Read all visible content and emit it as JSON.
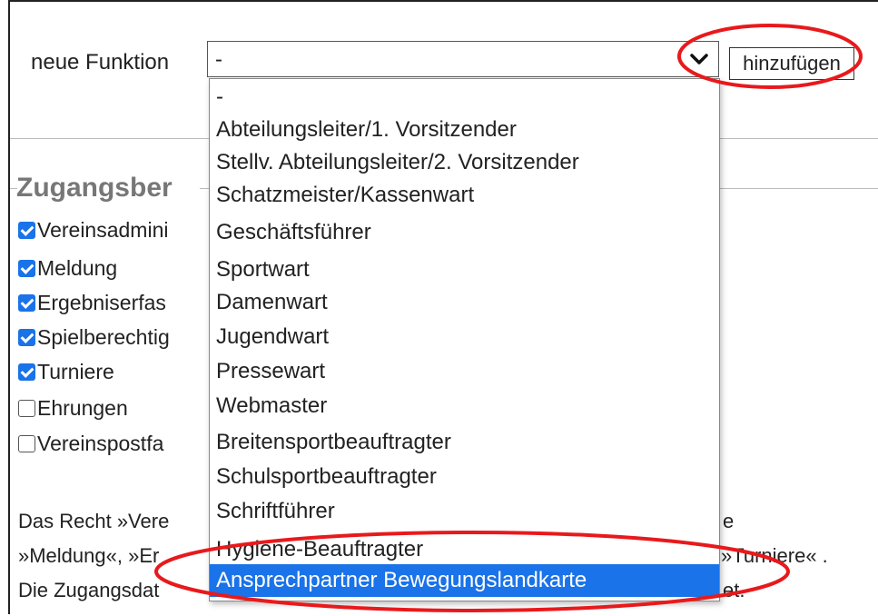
{
  "form": {
    "function_label": "neue Funktion",
    "select_value": "-",
    "add_button_label": "hinzufügen"
  },
  "dropdown": {
    "options": [
      "-",
      "Abteilungsleiter/1. Vorsitzender",
      "Stellv. Abteilungsleiter/2. Vorsitzender",
      "Schatzmeister/Kassenwart",
      "Geschäftsführer",
      "Sportwart",
      "Damenwart",
      "Jugendwart",
      "Pressewart",
      "Webmaster",
      "Breitensportbeauftragter",
      "Schulsportbeauftragter",
      "Schriftführer",
      "Hygiene-Beauftragter",
      "Ansprechpartner Bewegungslandkarte"
    ],
    "highlighted_option": "Ansprechpartner Bewegungslandkarte"
  },
  "access": {
    "section_title": "Zugangsber",
    "permissions": [
      {
        "label": "Vereinsadmini",
        "checked": true
      },
      {
        "label": "Meldung",
        "checked": true
      },
      {
        "label": "Ergebniserfas",
        "checked": true
      },
      {
        "label": "Spielberechtig",
        "checked": true
      },
      {
        "label": "Turniere",
        "checked": true
      },
      {
        "label": "Ehrungen",
        "checked": false
      },
      {
        "label": "Vereinspostfa",
        "checked": false
      }
    ],
    "paragraph": {
      "line1_start": "Das Recht »Vere",
      "line1_end": "e",
      "line2_start": "»Meldung«, »Er",
      "line2_end": "»Turniere« .",
      "line3_start": "Die Zugangsdat",
      "line3_end": "et."
    }
  },
  "colors": {
    "accent": "#1a73e8",
    "annotation": "#e8191c",
    "section_title": "#777777"
  }
}
